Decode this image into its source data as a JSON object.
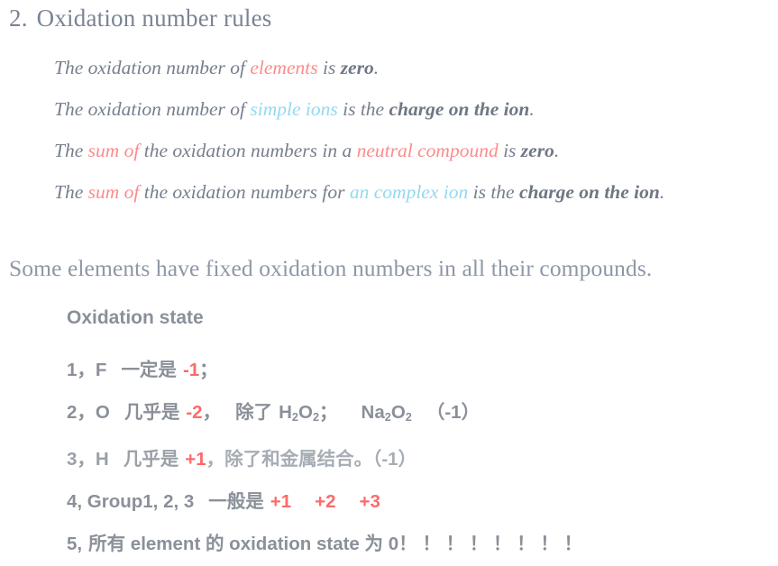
{
  "heading": {
    "number": "2.",
    "text": "Oxidation number rules"
  },
  "rules": [
    {
      "segments": [
        {
          "text": "The oxidation number of ",
          "style": "plain"
        },
        {
          "text": "elements",
          "style": "pink"
        },
        {
          "text": " is ",
          "style": "plain"
        },
        {
          "text": "zero",
          "style": "bold"
        },
        {
          "text": ".",
          "style": "plain"
        }
      ]
    },
    {
      "segments": [
        {
          "text": "The oxidation number of ",
          "style": "plain"
        },
        {
          "text": "simple ions",
          "style": "blue"
        },
        {
          "text": " is the ",
          "style": "plain"
        },
        {
          "text": "charge on the ion",
          "style": "bold"
        },
        {
          "text": ".",
          "style": "plain"
        }
      ]
    },
    {
      "segments": [
        {
          "text": "The ",
          "style": "plain"
        },
        {
          "text": "sum of",
          "style": "pink"
        },
        {
          "text": " the oxidation numbers in a ",
          "style": "plain"
        },
        {
          "text": "neutral compound",
          "style": "pink"
        },
        {
          "text": " is ",
          "style": "plain"
        },
        {
          "text": "zero",
          "style": "bold"
        },
        {
          "text": ".",
          "style": "plain"
        }
      ]
    },
    {
      "segments": [
        {
          "text": "The ",
          "style": "plain"
        },
        {
          "text": "sum of",
          "style": "pink"
        },
        {
          "text": " the oxidation numbers for ",
          "style": "plain"
        },
        {
          "text": "an complex ion",
          "style": "blue"
        },
        {
          "text": " is the ",
          "style": "plain"
        },
        {
          "text": "charge on the ion",
          "style": "bold"
        },
        {
          "text": ".",
          "style": "plain"
        }
      ]
    }
  ],
  "statement": "Some elements have fixed oxidation numbers in all their compounds.",
  "list": {
    "header": "Oxidation state",
    "items": [
      {
        "id": "rule-1-fluorine",
        "prefix": "1，F",
        "body": "一定是",
        "value": "-1",
        "suffix": "；",
        "formulas": "",
        "note": ""
      },
      {
        "id": "rule-2-oxygen",
        "prefix": "2，O",
        "body": "几乎是",
        "value": "-2",
        "suffix": "，",
        "formulas": "除了 H2O2；  Na2O2 （-1）",
        "note": ""
      },
      {
        "id": "rule-3-hydrogen",
        "prefix": "3，H",
        "body": "几乎是",
        "value": "+1",
        "suffix": "，",
        "formulas": "",
        "note": "除了和金属结合。（-1）"
      },
      {
        "id": "rule-4-groups",
        "prefix": "4, Group1, 2, 3",
        "body": "一般是",
        "value": "+1",
        "value2": "+2",
        "value3": "+3",
        "suffix": "",
        "formulas": "",
        "note": ""
      },
      {
        "id": "rule-5-elements",
        "prefix": "5,",
        "body": "所有 element 的 oxidation state 为 0",
        "value": "",
        "suffix": "",
        "formulas": "",
        "note": "！ ！ ！ ！ ！ ！ ！ ！"
      }
    ]
  },
  "colors": {
    "heading": "#7a8494",
    "body_gray": "#767f8c",
    "pink": "#fd8b8b",
    "blue": "#93d9f2",
    "red_value": "#fd6a6a",
    "list_gray": "#8a9099",
    "background": "#ffffff"
  },
  "tokens": {
    "f_2": "2",
    "h2o2_h": "H",
    "h2o2_o": "O",
    "na2o2_na": "Na",
    "na2o2_o": "O",
    "semicolon": "；",
    "paren_neg1": "（-1）",
    "chucle": "除了",
    "kongge": " "
  }
}
